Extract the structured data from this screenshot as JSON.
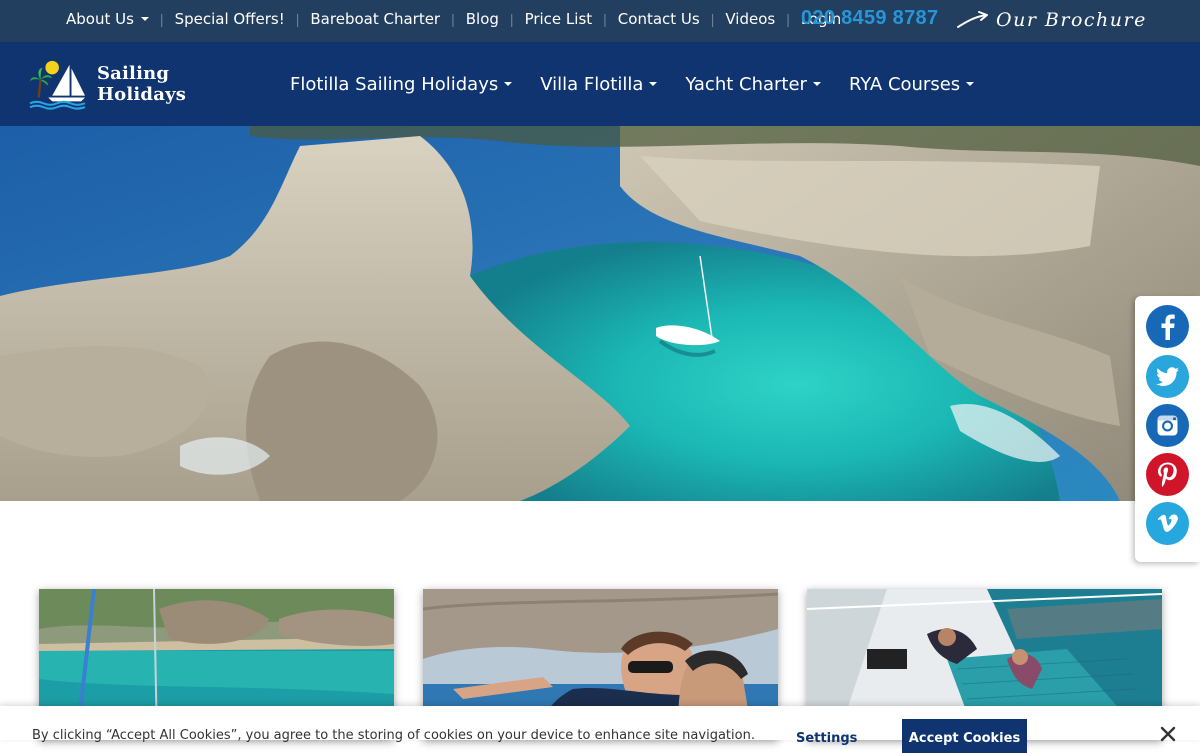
{
  "topnav": {
    "items": [
      {
        "label": "About Us",
        "dropdown": true
      },
      {
        "label": "Special Offers!"
      },
      {
        "label": "Bareboat Charter"
      },
      {
        "label": "Blog"
      },
      {
        "label": "Price List"
      },
      {
        "label": "Contact Us"
      },
      {
        "label": "Videos"
      },
      {
        "label": "Login"
      }
    ],
    "phone": "020 8459 8787",
    "brochure": "Our Brochure"
  },
  "brand": {
    "name": "Sailing Holidays",
    "logo_icon": "sailboat-palm-logo-icon"
  },
  "mainnav": {
    "items": [
      {
        "label": "Flotilla Sailing Holidays"
      },
      {
        "label": "Villa Flotilla"
      },
      {
        "label": "Yacht Charter"
      },
      {
        "label": "RYA Courses"
      }
    ]
  },
  "social": [
    {
      "name": "facebook-icon",
      "color": "#1769b8"
    },
    {
      "name": "twitter-icon",
      "color": "#29a6dc"
    },
    {
      "name": "instagram-icon",
      "color": "#1769b8"
    },
    {
      "name": "pinterest-icon",
      "color": "#d0142a"
    },
    {
      "name": "vimeo-icon",
      "color": "#26a7dd"
    }
  ],
  "cookie": {
    "text": "By clicking “Accept All Cookies”, you agree to the storing of cookies on your device to enhance site navigation.",
    "settings": "Settings",
    "accept": "Accept Cookies"
  },
  "colors": {
    "topbar": "#233f5f",
    "mainbar": "#0f3470",
    "accent": "#2596d8"
  }
}
